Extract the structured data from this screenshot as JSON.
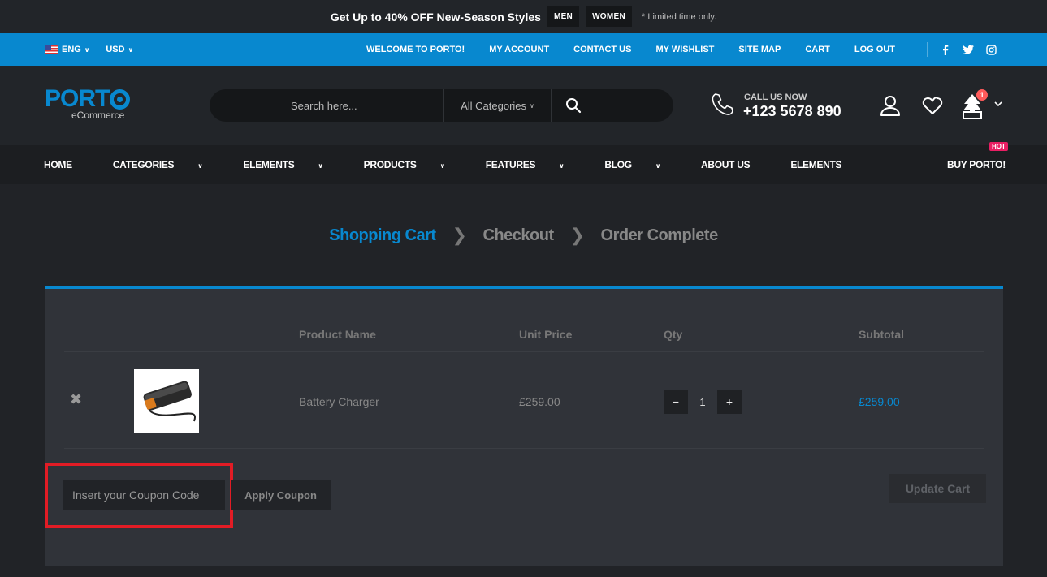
{
  "promo": {
    "prefix": "Get Up to ",
    "highlight": "40% OFF",
    "suffix": " New-Season Styles",
    "btn_men": "MEN",
    "btn_women": "WOMEN",
    "note": "* Limited time only."
  },
  "topbar": {
    "language": "ENG",
    "currency": "USD",
    "links": [
      "WELCOME TO PORTO!",
      "MY ACCOUNT",
      "CONTACT US",
      "MY WISHLIST",
      "SITE MAP",
      "CART",
      "LOG OUT"
    ],
    "social": [
      "f",
      "t",
      "i"
    ]
  },
  "header": {
    "logo_main": "PORT",
    "logo_sub": "eCommerce",
    "search_placeholder": "Search here...",
    "search_category": "All Categories",
    "call_label": "CALL US NOW",
    "call_number": "+123 5678 890",
    "cart_count": "1"
  },
  "nav": {
    "items": [
      "HOME",
      "CATEGORIES",
      "ELEMENTS",
      "PRODUCTS",
      "FEATURES",
      "BLOG",
      "ABOUT US",
      "ELEMENTS"
    ],
    "buy": "BUY PORTO!",
    "hot": "HOT"
  },
  "steps": [
    "Shopping Cart",
    "Checkout",
    "Order Complete"
  ],
  "cart": {
    "columns": [
      "Product Name",
      "Unit Price",
      "Qty",
      "Subtotal"
    ],
    "item": {
      "name": "Battery Charger",
      "price": "£259.00",
      "qty": "1",
      "subtotal": "£259.00"
    },
    "coupon_placeholder": "Insert your Coupon Code",
    "apply_label": "Apply Coupon",
    "update_label": "Update Cart"
  },
  "colors": {
    "accent": "#0888cf",
    "highlight_box": "#e21c25",
    "hot_badge": "#e91e63",
    "cart_badge": "#ff5b5b"
  }
}
